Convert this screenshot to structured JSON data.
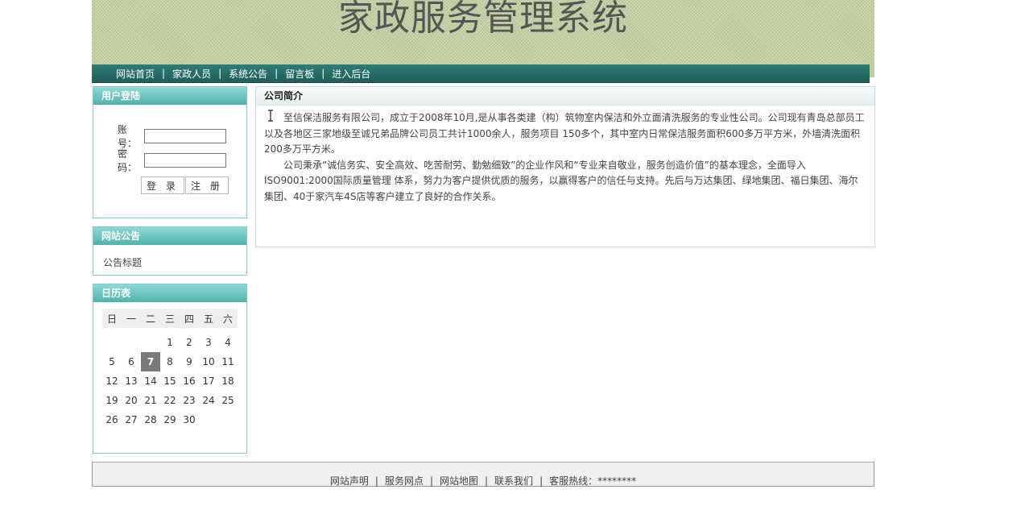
{
  "header": {
    "title": "家政服务管理系统"
  },
  "nav": {
    "items": [
      {
        "label": "网站首页"
      },
      {
        "label": "家政人员"
      },
      {
        "label": "系统公告"
      },
      {
        "label": "留言板"
      },
      {
        "label": "进入后台"
      }
    ],
    "separator": "|"
  },
  "login": {
    "title": "用户登陆",
    "account_label": "账号：",
    "password_label": "密码：",
    "account_value": "",
    "password_value": "",
    "login_button": "登 录",
    "register_button": "注 册"
  },
  "notice": {
    "title": "网站公告",
    "items": [
      {
        "label": "公告标题"
      }
    ]
  },
  "calendar": {
    "title": "日历表",
    "weekdays": [
      "日",
      "一",
      "二",
      "三",
      "四",
      "五",
      "六"
    ],
    "weeks": [
      [
        "",
        "",
        "",
        "1",
        "2",
        "3",
        "4"
      ],
      [
        "5",
        "6",
        "7",
        "8",
        "9",
        "10",
        "11"
      ],
      [
        "12",
        "13",
        "14",
        "15",
        "16",
        "17",
        "18"
      ],
      [
        "19",
        "20",
        "21",
        "22",
        "23",
        "24",
        "25"
      ],
      [
        "26",
        "27",
        "28",
        "29",
        "30",
        "",
        ""
      ]
    ],
    "today": "7"
  },
  "intro": {
    "title": "公司简介",
    "paragraphs": [
      "至信保洁服务有限公司，成立于2008年10月,是从事各类建（构）筑物室内保洁和外立面清洗服务的专业性公司。公司现有青岛总部员工以及各地区三家地级至诚兄弟品牌公司员工共计1000余人，服务项目 150多个，其中室内日常保洁服务面积600多万平方米，外墙清洗面积200多万平方米。",
      "公司秉承“诚信务实、安全高效、吃苦耐劳、勤勉细致”的企业作风和“专业来自敬业，服务创造价值”的基本理念，全面导入ISO9001:2000国际质量管理 体系，努力为客户提供优质的服务，以赢得客户的信任与支持。先后与万达集团、绿地集团、福日集团、海尔集团、40于家汽车4S店等客户建立了良好的合作关系。"
    ]
  },
  "footer": {
    "links": [
      {
        "label": "网站声明"
      },
      {
        "label": "服务网点"
      },
      {
        "label": "网站地图"
      },
      {
        "label": "联系我们"
      }
    ],
    "hotline": "客服热线：********",
    "separator": "|"
  }
}
